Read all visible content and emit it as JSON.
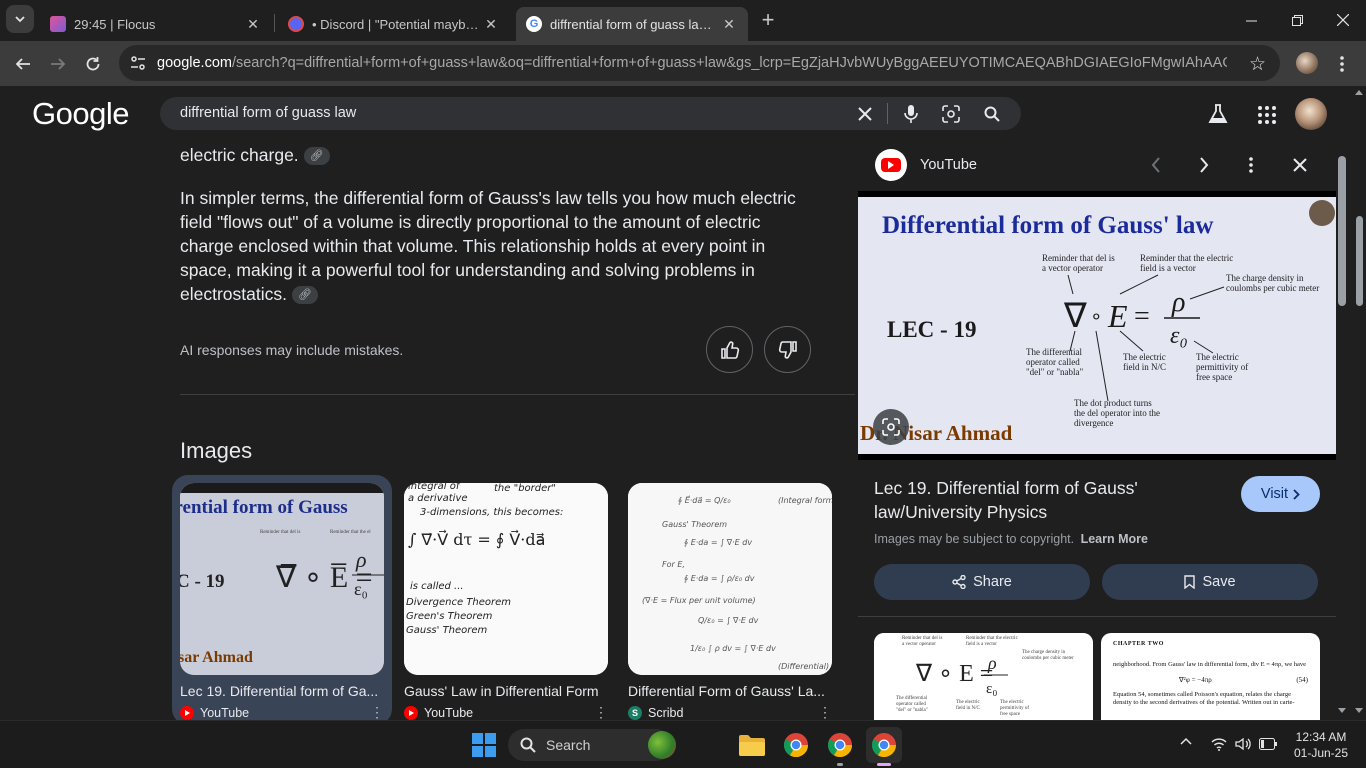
{
  "browser": {
    "tabs": [
      {
        "title": "29:45 | Flocus",
        "active": false
      },
      {
        "title": "• Discord | \"Potential maybe?\" |",
        "active": false
      },
      {
        "title": "diffrential form of guass law - G",
        "active": true
      }
    ],
    "url_host": "google.com",
    "url_rest": "/search?q=diffrential+form+of+guass+law&oq=diffrential+form+of+guass+law&gs_lcrp=EgZjaHJvbWUyBggAEEUYOTIMCAEQABhDGIAEGIoFMgwIAhAAGEMYg..."
  },
  "google": {
    "logo": "Google",
    "query": "diffrential form of guass law"
  },
  "ai_overview": {
    "fragment": "electric charge.",
    "paragraph": "In simpler terms, the differential form of Gauss's law tells you how much electric field \"flows out\" of a volume is directly proportional to the amount of electric charge enclosed within that volume. This relationship holds at every point in space, making it a powerful tool for understanding and solving problems in electrostatics.",
    "disclaimer": "AI responses may include mistakes."
  },
  "images": {
    "heading": "Images",
    "cards": [
      {
        "title": "Lec 19. Differential form of Ga...",
        "source": "YouTube"
      },
      {
        "title": "Gauss' Law in Differential Form",
        "source": "YouTube"
      },
      {
        "title": "Differential Form of Gauss' La...",
        "source": "Scribd"
      }
    ]
  },
  "panel": {
    "source": "YouTube",
    "preview": {
      "heading": "Differential form of Gauss' law",
      "lec": "LEC - 19",
      "author": "Dr. Nisar Ahmad",
      "notes": {
        "del": "Reminder that del is a vector operator",
        "field": "Reminder that the electric field is a vector",
        "rho": "The charge density in coulombs per cubic meter",
        "nabla": "The differential operator called \"del\" or \"nabla\"",
        "e": "The electric field in N/C",
        "eps": "The electric permittivity of free space",
        "dot": "The dot product turns the del operator into the divergence"
      }
    },
    "title": "Lec 19. Differential form of Gauss' law/University Physics",
    "visit_label": "Visit",
    "copyright": "Images may be subject to copyright.",
    "learn_more": "Learn More",
    "share_label": "Share",
    "save_label": "Save",
    "related2": {
      "header": "CHAPTER TWO",
      "line1": "neighborhood. From Gauss' law in differential form, div E = 4πρ, we have",
      "eq": "∇²φ = −4πρ",
      "eqnum": "(54)",
      "line2": "Equation 54, sometimes called Poisson's equation, relates the charge density to the second derivatives of the potential. Written out in carte-"
    }
  },
  "taskbar": {
    "search_label": "Search",
    "time": "12:34 AM",
    "date": "01-Jun-25"
  },
  "colors": {
    "accent_blue": "#8ab4f8",
    "panel_button": "#303d51",
    "visit_button": "#a8c7fa"
  }
}
